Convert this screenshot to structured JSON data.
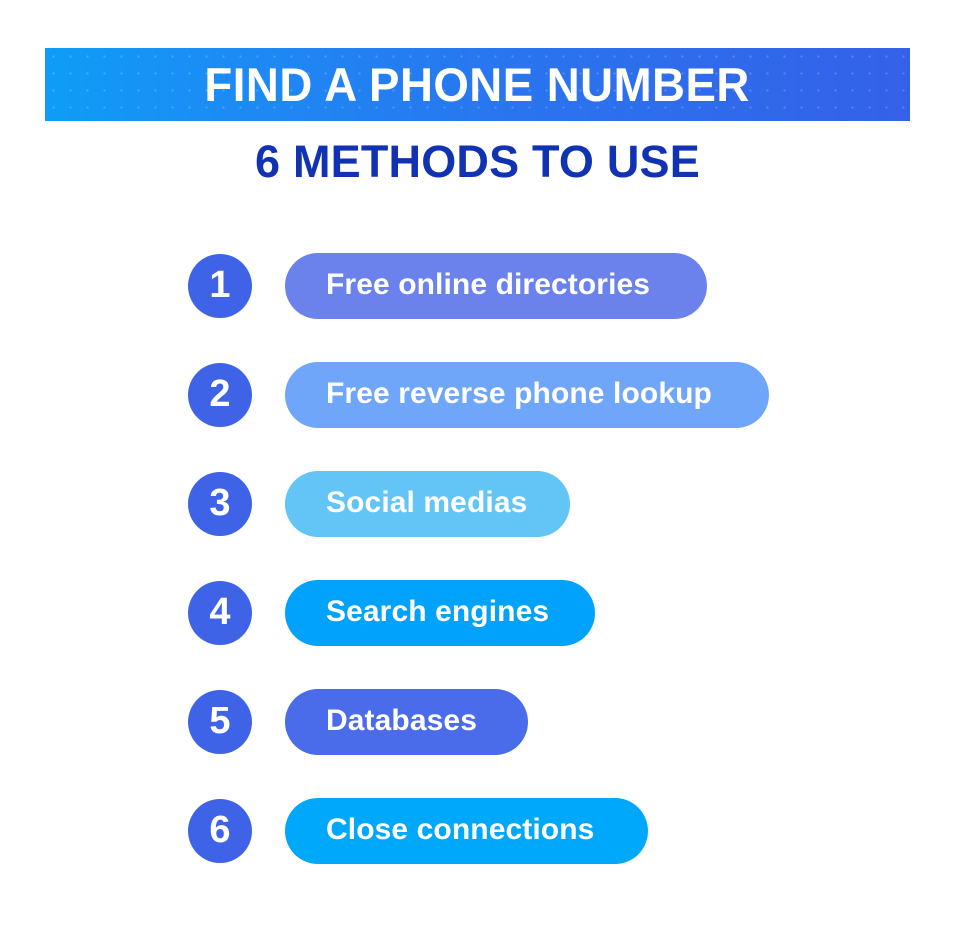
{
  "header": {
    "banner_title": "FIND A PHONE NUMBER",
    "banner_gradient_start": "#0E9DF7",
    "banner_gradient_end": "#3461E8",
    "subtitle": "6 METHODS TO USE",
    "subtitle_color": "#1132B2"
  },
  "badge_color": "#3F63E6",
  "methods": [
    {
      "number": "1",
      "label": "Free online directories",
      "pill_color": "#6B82EC",
      "pill_width": 422
    },
    {
      "number": "2",
      "label": "Free reverse phone lookup",
      "pill_color": "#6FA6FA",
      "pill_width": 484
    },
    {
      "number": "3",
      "label": "Social medias",
      "pill_color": "#62C5F5",
      "pill_width": 285
    },
    {
      "number": "4",
      "label": "Search engines",
      "pill_color": "#00A2FB",
      "pill_width": 310
    },
    {
      "number": "5",
      "label": "Databases",
      "pill_color": "#4A6BEA",
      "pill_width": 243
    },
    {
      "number": "6",
      "label": "Close connections",
      "pill_color": "#00A8FB",
      "pill_width": 363
    }
  ]
}
